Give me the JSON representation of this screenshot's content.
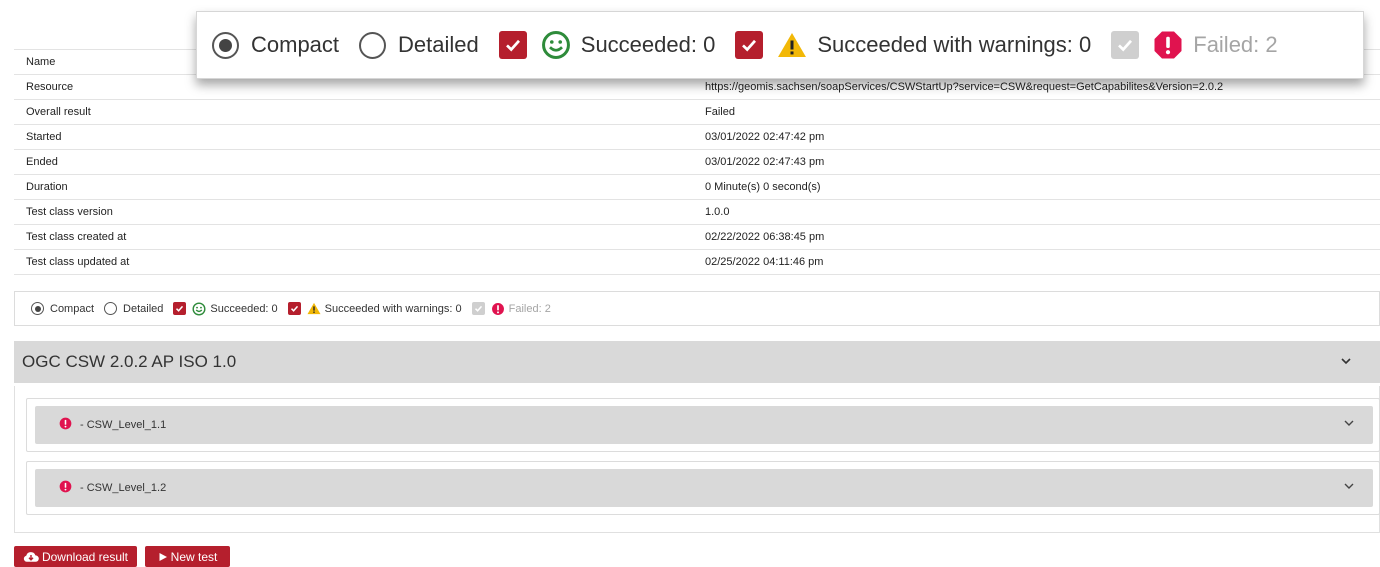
{
  "details": [
    {
      "label": "Name",
      "value": ""
    },
    {
      "label": "Resource",
      "value": "https://geomis.sachsen/soapServices/CSWStartUp?service=CSW&request=GetCapabilites&Version=2.0.2"
    },
    {
      "label": "Overall result",
      "value": "Failed"
    },
    {
      "label": "Started",
      "value": "03/01/2022 02:47:42 pm"
    },
    {
      "label": "Ended",
      "value": "03/01/2022 02:47:43 pm"
    },
    {
      "label": "Duration",
      "value": "0 Minute(s) 0 second(s)"
    },
    {
      "label": "Test class version",
      "value": "1.0.0"
    },
    {
      "label": "Test class created at",
      "value": "02/22/2022 06:38:45 pm"
    },
    {
      "label": "Test class updated at",
      "value": "02/25/2022 04:11:46 pm"
    }
  ],
  "filter": {
    "compact_label": "Compact",
    "detailed_label": "Detailed",
    "succeeded_label": "Succeeded: 0",
    "warnings_label": "Succeeded with warnings: 0",
    "failed_label": "Failed: 2",
    "selected_view": "Compact"
  },
  "suite": {
    "title": "OGC CSW 2.0.2 AP ISO 1.0",
    "items": [
      {
        "label": "- CSW_Level_1.1",
        "status_icon": "error-icon"
      },
      {
        "label": "- CSW_Level_1.2",
        "status_icon": "error-icon"
      }
    ]
  },
  "buttons": {
    "download_label": "Download result",
    "new_test_label": "New test"
  },
  "colors": {
    "accent": "#b51f2d",
    "success": "#2e8b3a",
    "warning": "#f2b807",
    "error": "#e0134f",
    "header_bg": "#d9d9d9"
  }
}
